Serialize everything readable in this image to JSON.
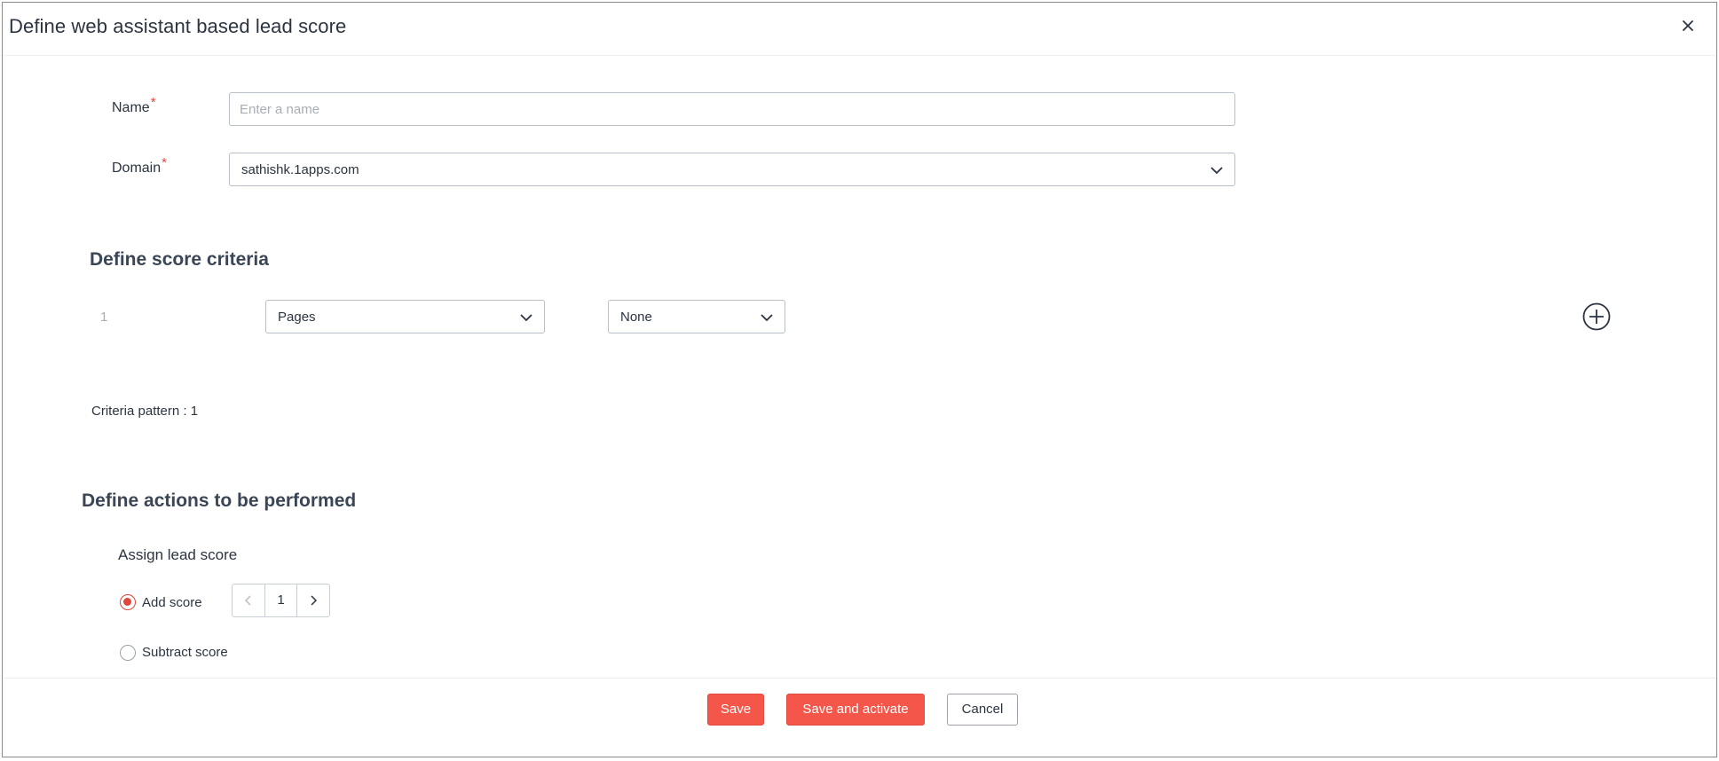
{
  "modal": {
    "title": "Define web assistant based lead score"
  },
  "form": {
    "name": {
      "label": "Name",
      "required_mark": "*",
      "placeholder": "Enter a name",
      "value": ""
    },
    "domain": {
      "label": "Domain",
      "required_mark": "*",
      "selected": "sathishk.1apps.com"
    }
  },
  "criteria": {
    "title": "Define score criteria",
    "rows": [
      {
        "index": "1",
        "field": "Pages",
        "operator": "None"
      }
    ],
    "pattern_label": "Criteria pattern : 1"
  },
  "actions": {
    "title": "Define actions to be performed",
    "subtitle": "Assign lead score",
    "options": [
      {
        "label": "Add score",
        "checked": true
      },
      {
        "label": "Subtract score",
        "checked": false
      }
    ],
    "score_value": "1"
  },
  "footer": {
    "save_label": "Save",
    "save_activate_label": "Save and activate",
    "cancel_label": "Cancel"
  },
  "colors": {
    "accent": "#f4574a",
    "required": "#e0463e",
    "border": "#b9bfc6",
    "text": "#2b3440"
  },
  "icons": {
    "close": "close-icon",
    "chevron": "chevron-down-icon",
    "add": "plus-circle-icon",
    "decrement": "chevron-left-icon",
    "increment": "chevron-right-icon"
  }
}
